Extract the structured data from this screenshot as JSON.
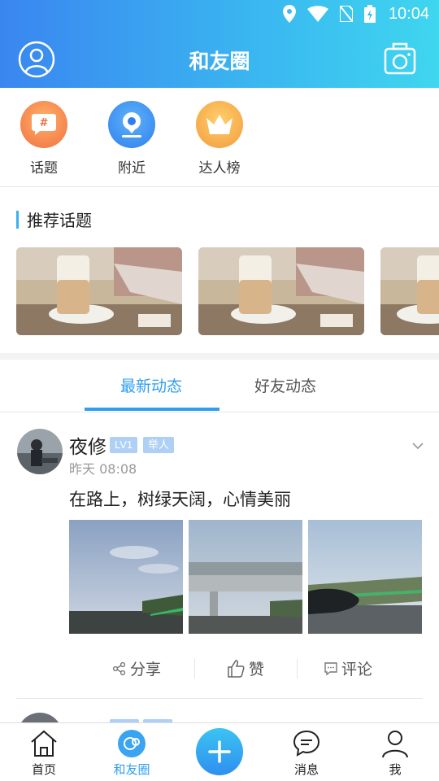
{
  "status_bar": {
    "time": "10:04"
  },
  "header": {
    "title": "和友圈"
  },
  "quick_entries": [
    {
      "label": "话题",
      "icon": "hashtag-icon",
      "color": "#f5845a"
    },
    {
      "label": "附近",
      "icon": "location-icon",
      "color": "#3d8ff0"
    },
    {
      "label": "达人榜",
      "icon": "crown-icon",
      "color": "#f5a94a"
    }
  ],
  "recommended": {
    "title": "推荐话题"
  },
  "tabs": [
    {
      "label": "最新动态",
      "active": true
    },
    {
      "label": "好友动态",
      "active": false
    }
  ],
  "post": {
    "author": "夜修",
    "badges": [
      "LV1",
      "举人"
    ],
    "time": "昨天 08:08",
    "text": "在路上，树绿天阔，心情美丽",
    "actions": {
      "share": "分享",
      "like": "赞",
      "comment": "评论"
    }
  },
  "bottom_nav": [
    {
      "label": "首页",
      "icon": "home-icon",
      "active": false
    },
    {
      "label": "和友圈",
      "icon": "circle-icon",
      "active": true
    },
    {
      "label": "消息",
      "icon": "message-icon",
      "active": false
    },
    {
      "label": "我",
      "icon": "person-icon",
      "active": false
    }
  ],
  "colors": {
    "accent": "#2f9ef0",
    "header_start": "#3a86f0",
    "header_end": "#3fd6ef",
    "badge": "#aed0f5"
  }
}
